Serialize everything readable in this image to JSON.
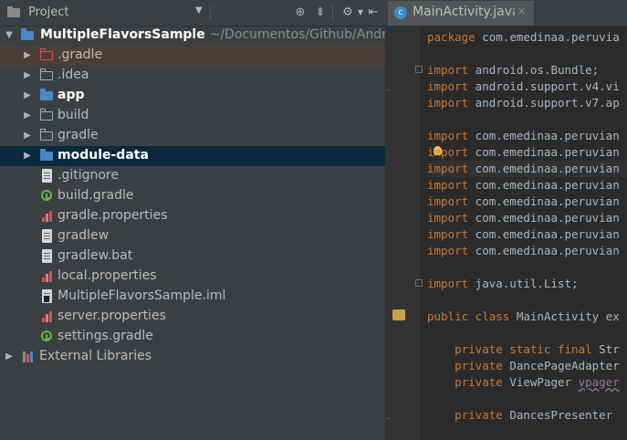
{
  "project_panel": {
    "title": "Project",
    "tree": [
      {
        "label": "MultipleFlavorsSample",
        "path": "~/Documentos/Github/Android",
        "depth": 0,
        "arrow": "down",
        "icon": "module-folder-icon",
        "bold": true
      },
      {
        "label": ".gradle",
        "depth": 1,
        "arrow": "right",
        "icon": "folder-icon",
        "state": "excluded"
      },
      {
        "label": ".idea",
        "depth": 1,
        "arrow": "right",
        "icon": "folder-icon"
      },
      {
        "label": "app",
        "depth": 1,
        "arrow": "right",
        "icon": "module-folder-icon",
        "bold": true
      },
      {
        "label": "build",
        "depth": 1,
        "arrow": "right",
        "icon": "folder-icon"
      },
      {
        "label": "gradle",
        "depth": 1,
        "arrow": "right",
        "icon": "folder-icon"
      },
      {
        "label": "module-data",
        "depth": 1,
        "arrow": "right",
        "icon": "module-folder-icon",
        "bold": true,
        "state": "selected"
      },
      {
        "label": ".gitignore",
        "depth": 1,
        "icon": "text-file-icon"
      },
      {
        "label": "build.gradle",
        "depth": 1,
        "icon": "gradle-file-icon"
      },
      {
        "label": "gradle.properties",
        "depth": 1,
        "icon": "properties-file-icon"
      },
      {
        "label": "gradlew",
        "depth": 1,
        "icon": "text-file-icon"
      },
      {
        "label": "gradlew.bat",
        "depth": 1,
        "icon": "text-file-icon"
      },
      {
        "label": "local.properties",
        "depth": 1,
        "icon": "properties-file-icon"
      },
      {
        "label": "MultipleFlavorsSample.iml",
        "depth": 1,
        "icon": "iml-file-icon"
      },
      {
        "label": "server.properties",
        "depth": 1,
        "icon": "properties-file-icon"
      },
      {
        "label": "settings.gradle",
        "depth": 1,
        "icon": "gradle-file-icon"
      },
      {
        "label": "External Libraries",
        "depth": 0,
        "arrow": "right",
        "icon": "libraries-icon"
      }
    ]
  },
  "editor": {
    "tab_label": "MainActivity.java",
    "lines": [
      {
        "kw": "package",
        "text": " com.emedinaa.peruvia"
      },
      {
        "kw": "",
        "text": ""
      },
      {
        "kw": "import",
        "text": " android.os.Bundle;"
      },
      {
        "kw": "import",
        "text": " android.support.v4.vi"
      },
      {
        "kw": "import",
        "text": " android.support.v7.ap"
      },
      {
        "kw": "",
        "text": ""
      },
      {
        "kw": "import",
        "text": " com.emedinaa.peruvian"
      },
      {
        "kw": "import",
        "text": " com.emedinaa.peruvian"
      },
      {
        "kw": "import",
        "text": " com.emedinaa.peruvian"
      },
      {
        "kw": "import",
        "text": " com.emedinaa.peruvian"
      },
      {
        "kw": "import",
        "text": " com.emedinaa.peruvian"
      },
      {
        "kw": "import",
        "text": " com.emedinaa.peruvian"
      },
      {
        "kw": "import",
        "text": " com.emedinaa.peruvian"
      },
      {
        "kw": "import",
        "text": " com.emedinaa.peruvian"
      },
      {
        "kw": "",
        "text": ""
      },
      {
        "kw": "import",
        "text": " java.util.List;"
      },
      {
        "kw": "",
        "text": ""
      },
      {
        "kw": "public class",
        "text": " MainActivity ex"
      },
      {
        "kw": "",
        "text": ""
      },
      {
        "kw": "    private static final",
        "text": " Str"
      },
      {
        "kw": "    private",
        "text": " DancePageAdapter"
      },
      {
        "kw": "    private",
        "text": " ViewPager ",
        "extra": "vpager"
      },
      {
        "kw": "",
        "text": ""
      },
      {
        "kw": "    private",
        "text": " DancesPresenter"
      }
    ]
  },
  "colors": {
    "panel_bg": "#3c3f41",
    "editor_bg": "#2b2b2b",
    "keyword": "#cc7832",
    "code_text": "#a9b7c6",
    "selection_blue": "#0d293e",
    "excluded_folder": "#d25252"
  }
}
